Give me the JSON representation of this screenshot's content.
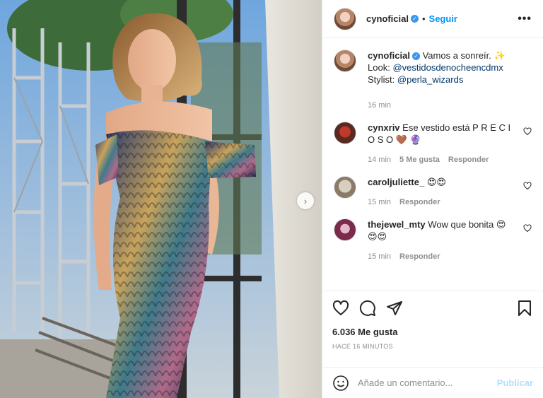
{
  "post": {
    "username": "cynoficial",
    "follow_label": "Seguir",
    "more_label": "•••",
    "caption": {
      "username": "cynoficial",
      "text": "Vamos a sonreír. ✨",
      "look_label": "Look:",
      "look_handle": "@vestidosdenocheencdmx",
      "stylist_label": "Stylist:",
      "stylist_handle": "@perla_wizards",
      "time": "16 min"
    },
    "comments": [
      {
        "username": "cynxriv",
        "text": "Ese vestido está P R E C I O S O 🤎 🔮",
        "time": "14 min",
        "likes": "5 Me gusta",
        "reply_label": "Responder"
      },
      {
        "username": "caroljuliette_",
        "text": "😍😍",
        "time": "15 min",
        "reply_label": "Responder"
      },
      {
        "username": "thejewel_mty",
        "text": "Wow que bonita 😍 😍😍",
        "time": "15 min",
        "reply_label": "Responder"
      }
    ],
    "likes_count": "6.036 Me gusta",
    "posted_ago": "HACE 16 MINUTOS",
    "add_comment_placeholder": "Añade un comentario...",
    "publish_label": "Publicar"
  },
  "icons": {
    "like": "heart-icon",
    "comment": "comment-icon",
    "share": "paper-plane-icon",
    "save": "bookmark-icon",
    "emoji": "smiley-icon",
    "next": "chevron-right-icon"
  },
  "colors": {
    "accent": "#0095f6",
    "verified": "#3897f0",
    "muted": "#8e8e8e",
    "publish_disabled": "#b2dffc"
  }
}
